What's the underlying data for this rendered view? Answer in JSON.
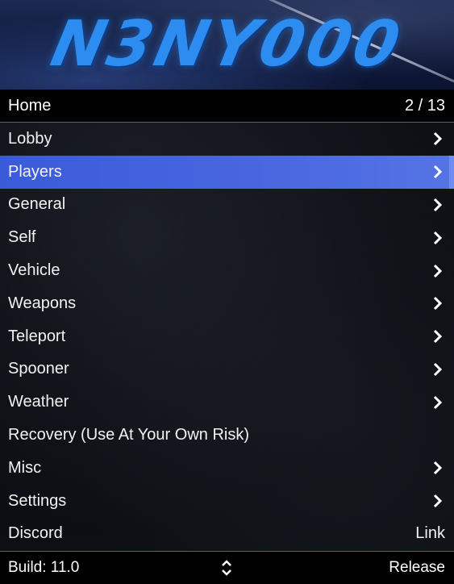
{
  "banner": {
    "logo_text": "N3NY000"
  },
  "header": {
    "title": "Home",
    "position": "2 / 13"
  },
  "items": [
    {
      "label": "Lobby",
      "right": "chevron-right-icon",
      "selected": false
    },
    {
      "label": "Players",
      "right": "chevron-right-icon",
      "selected": true
    },
    {
      "label": "General",
      "right": "chevron-right-icon",
      "selected": false
    },
    {
      "label": "Self",
      "right": "chevron-right-icon",
      "selected": false
    },
    {
      "label": "Vehicle",
      "right": "chevron-right-icon",
      "selected": false
    },
    {
      "label": "Weapons",
      "right": "chevron-right-icon",
      "selected": false
    },
    {
      "label": "Teleport",
      "right": "chevron-right-icon",
      "selected": false
    },
    {
      "label": "Spooner",
      "right": "chevron-right-icon",
      "selected": false
    },
    {
      "label": "Weather",
      "right": "chevron-right-icon",
      "selected": false
    },
    {
      "label": "Recovery (Use At Your Own Risk)",
      "right": "",
      "selected": false
    },
    {
      "label": "Misc",
      "right": "chevron-right-icon",
      "selected": false
    },
    {
      "label": "Settings",
      "right": "chevron-right-icon",
      "selected": false
    },
    {
      "label": "Discord",
      "right_text": "Link",
      "selected": false
    }
  ],
  "footer": {
    "build": "Build: 11.0",
    "arrows_icon": "up-down-arrows-icon",
    "release": "Release"
  },
  "colors": {
    "accent": "#3a63c8",
    "selected": "#4a67e0",
    "logo": "#2d8cf0"
  }
}
